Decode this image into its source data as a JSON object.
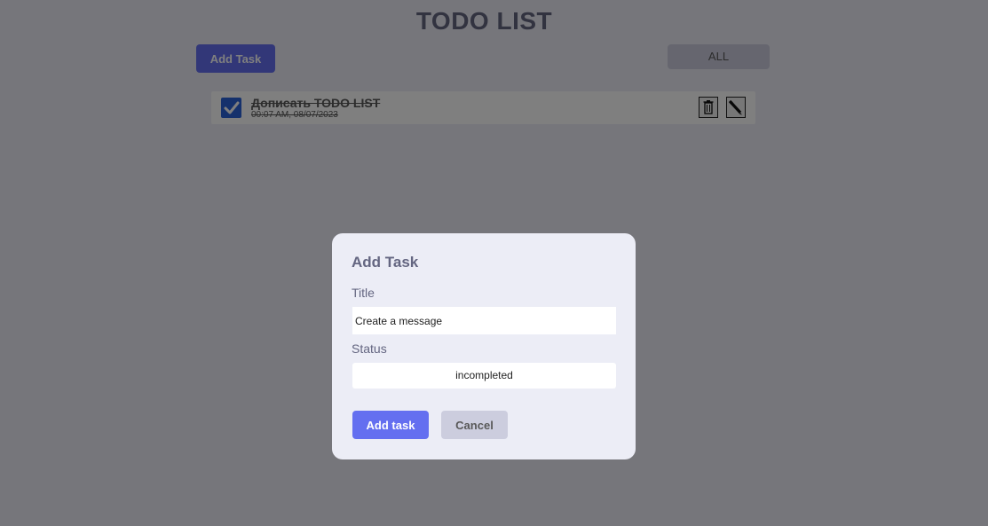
{
  "app": {
    "title": "TODO LIST",
    "add_task_label": "Add Task",
    "filter_value": "ALL"
  },
  "todos": [
    {
      "title": "Дописать TODO LIST",
      "time": "00:07 AM, 08/07/2023",
      "completed": true
    }
  ],
  "modal": {
    "title": "Add Task",
    "title_label": "Title",
    "title_value": "Create a message",
    "status_label": "Status",
    "status_value": "incompleted",
    "submit_label": "Add task",
    "cancel_label": "Cancel"
  },
  "colors": {
    "primary": "#646ff0",
    "secondary": "#cccdde",
    "background": "#ecedf6",
    "text": "#646681",
    "checkbox": "#2b63d9"
  },
  "icons": {
    "checkbox": "check-icon",
    "delete": "trash-icon",
    "edit": "pencil-icon"
  }
}
